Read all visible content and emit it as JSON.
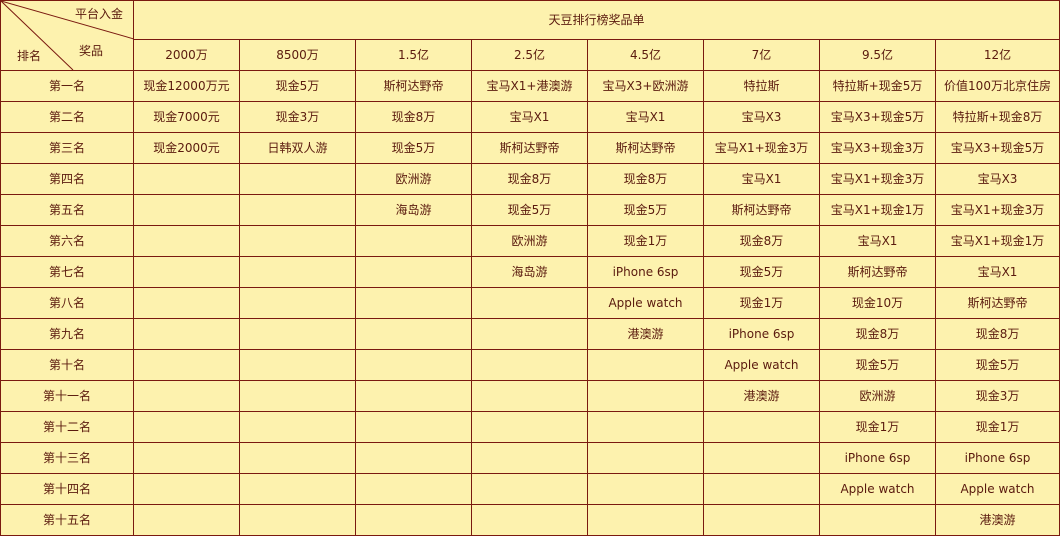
{
  "title": "天豆排行榜奖品单",
  "corner": {
    "top_label": "平台入金",
    "middle_label": "奖品",
    "bottom_label": "排名"
  },
  "amounts": [
    "2000万",
    "8500万",
    "1.5亿",
    "2.5亿",
    "4.5亿",
    "7亿",
    "9.5亿",
    "12亿"
  ],
  "rows": [
    {
      "rank": "第一名",
      "prizes": [
        "现金12000万元",
        "现金5万",
        "斯柯达野帝",
        "宝马X1+港澳游",
        "宝马X3+欧洲游",
        "特拉斯",
        "特拉斯+现金5万",
        "价值100万北京住房"
      ]
    },
    {
      "rank": "第二名",
      "prizes": [
        "现金7000元",
        "现金3万",
        "现金8万",
        "宝马X1",
        "宝马X1",
        "宝马X3",
        "宝马X3+现金5万",
        "特拉斯+现金8万"
      ]
    },
    {
      "rank": "第三名",
      "prizes": [
        "现金2000元",
        "日韩双人游",
        "现金5万",
        "斯柯达野帝",
        "斯柯达野帝",
        "宝马X1+现金3万",
        "宝马X3+现金3万",
        "宝马X3+现金5万"
      ]
    },
    {
      "rank": "第四名",
      "prizes": [
        "",
        "",
        "欧洲游",
        "现金8万",
        "现金8万",
        "宝马X1",
        "宝马X1+现金3万",
        "宝马X3"
      ]
    },
    {
      "rank": "第五名",
      "prizes": [
        "",
        "",
        "海岛游",
        "现金5万",
        "现金5万",
        "斯柯达野帝",
        "宝马X1+现金1万",
        "宝马X1+现金3万"
      ]
    },
    {
      "rank": "第六名",
      "prizes": [
        "",
        "",
        "",
        "欧洲游",
        "现金1万",
        "现金8万",
        "宝马X1",
        "宝马X1+现金1万"
      ]
    },
    {
      "rank": "第七名",
      "prizes": [
        "",
        "",
        "",
        "海岛游",
        "iPhone 6sp",
        "现金5万",
        "斯柯达野帝",
        "宝马X1"
      ]
    },
    {
      "rank": "第八名",
      "prizes": [
        "",
        "",
        "",
        "",
        "Apple watch",
        "现金1万",
        "现金10万",
        "斯柯达野帝"
      ]
    },
    {
      "rank": "第九名",
      "prizes": [
        "",
        "",
        "",
        "",
        "港澳游",
        "iPhone 6sp",
        "现金8万",
        "现金8万"
      ]
    },
    {
      "rank": "第十名",
      "prizes": [
        "",
        "",
        "",
        "",
        "",
        "Apple watch",
        "现金5万",
        "现金5万"
      ]
    },
    {
      "rank": "第十一名",
      "prizes": [
        "",
        "",
        "",
        "",
        "",
        "港澳游",
        "欧洲游",
        "现金3万"
      ]
    },
    {
      "rank": "第十二名",
      "prizes": [
        "",
        "",
        "",
        "",
        "",
        "",
        "现金1万",
        "现金1万"
      ]
    },
    {
      "rank": "第十三名",
      "prizes": [
        "",
        "",
        "",
        "",
        "",
        "",
        "iPhone 6sp",
        "iPhone 6sp"
      ]
    },
    {
      "rank": "第十四名",
      "prizes": [
        "",
        "",
        "",
        "",
        "",
        "",
        "Apple watch",
        "Apple watch"
      ]
    },
    {
      "rank": "第十五名",
      "prizes": [
        "",
        "",
        "",
        "",
        "",
        "",
        "",
        "港澳游"
      ]
    }
  ],
  "colors": {
    "background": "#fdf2ae",
    "border": "#7a1a10",
    "text": "#5a1a0e"
  }
}
